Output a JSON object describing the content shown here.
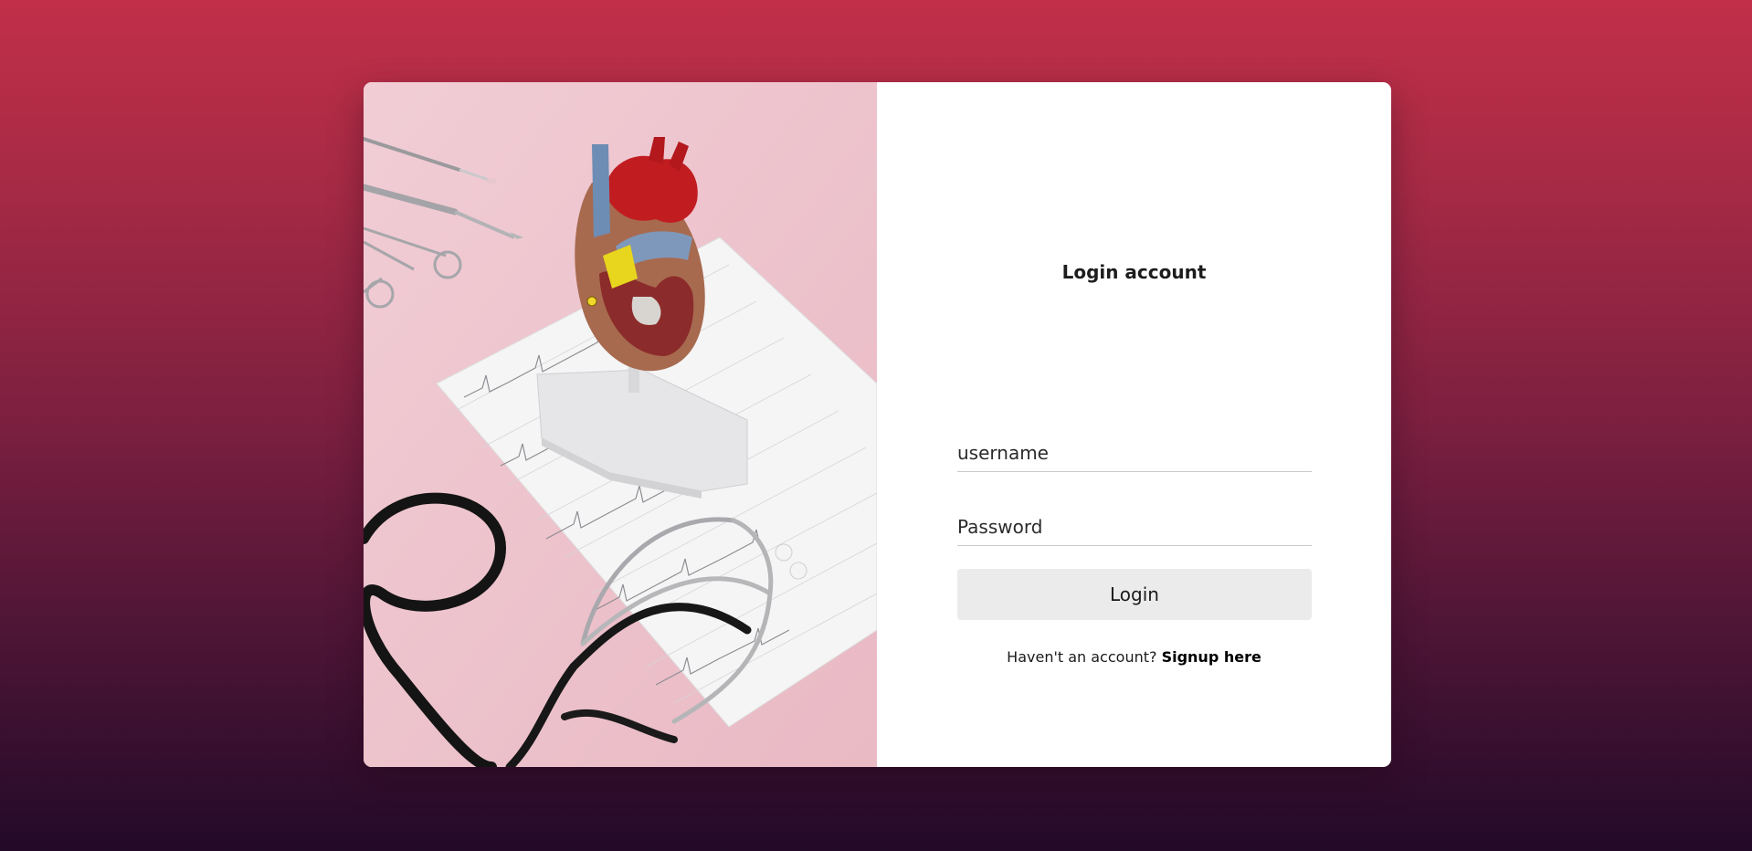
{
  "login": {
    "title": "Login account",
    "username_placeholder": "username",
    "password_placeholder": "Password",
    "login_button": "Login",
    "signup_prompt": "Haven't an account? ",
    "signup_link": "Signup here"
  }
}
